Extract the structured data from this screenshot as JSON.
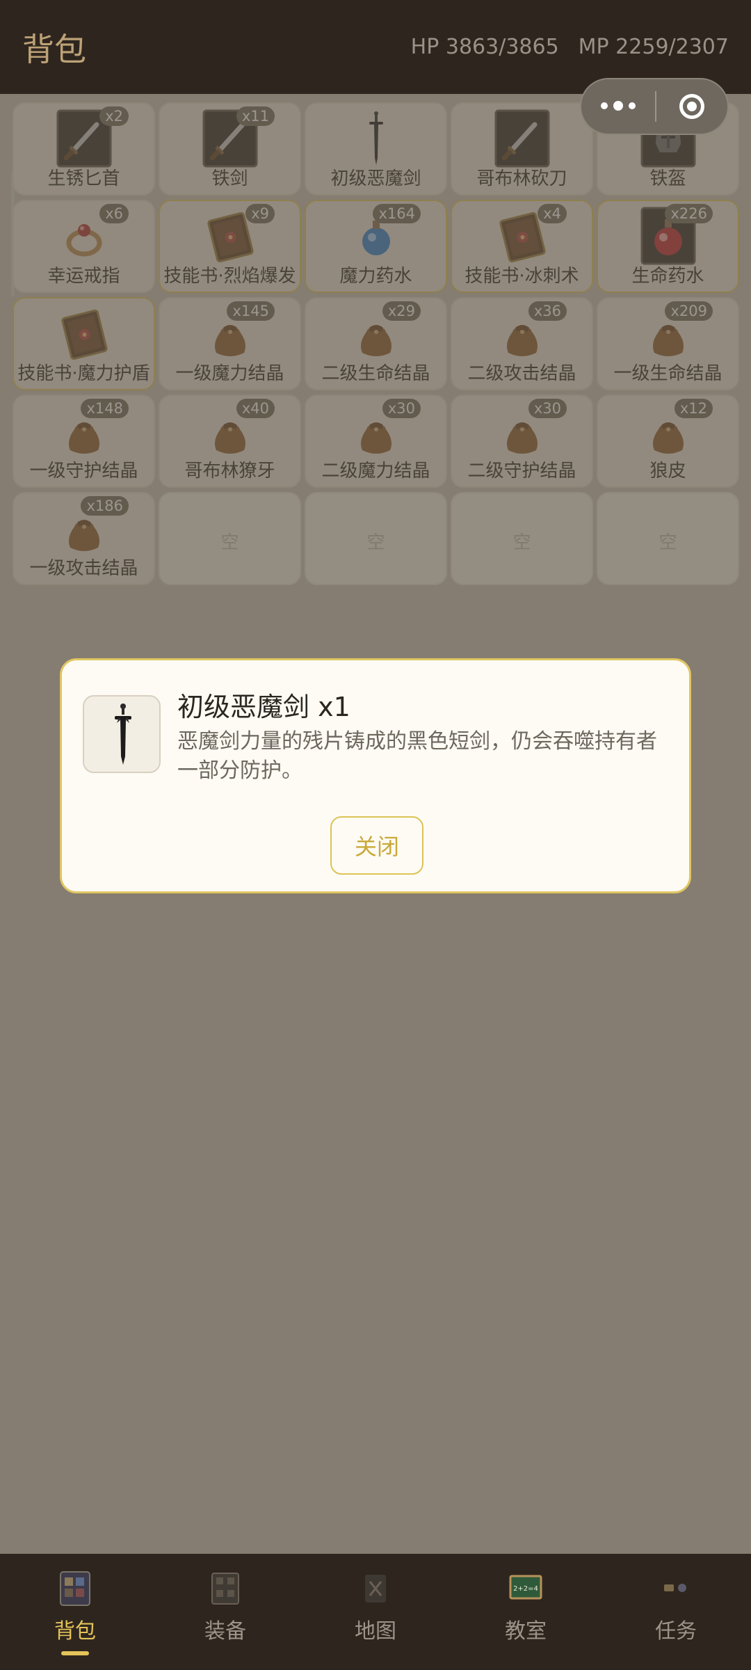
{
  "header": {
    "title": "背包",
    "hp": "HP 3863/3865",
    "mp": "MP 2259/2307"
  },
  "inventory": [
    {
      "name": "生锈匕首",
      "qty": "x2",
      "icon": "dagger-icon",
      "highlight": false
    },
    {
      "name": "铁剑",
      "qty": "x11",
      "icon": "sword-icon",
      "highlight": false
    },
    {
      "name": "初级恶魔剑",
      "qty": "",
      "icon": "demon-sword-icon",
      "highlight": false
    },
    {
      "name": "哥布林砍刀",
      "qty": "",
      "icon": "cleaver-icon",
      "highlight": false
    },
    {
      "name": "铁盔",
      "qty": "x",
      "icon": "helmet-icon",
      "highlight": false
    },
    {
      "name": "幸运戒指",
      "qty": "x6",
      "icon": "ring-icon",
      "highlight": false
    },
    {
      "name": "技能书·烈焰爆发",
      "qty": "x9",
      "icon": "skill-book-icon",
      "highlight": true
    },
    {
      "name": "魔力药水",
      "qty": "x164",
      "icon": "blue-potion-icon",
      "highlight": true
    },
    {
      "name": "技能书·冰刺术",
      "qty": "x4",
      "icon": "skill-book-icon",
      "highlight": true
    },
    {
      "name": "生命药水",
      "qty": "x226",
      "icon": "red-potion-icon",
      "highlight": true
    },
    {
      "name": "技能书·魔力护盾",
      "qty": "",
      "icon": "skill-book-icon",
      "highlight": true
    },
    {
      "name": "一级魔力结晶",
      "qty": "x145",
      "icon": "pouch-icon",
      "highlight": false
    },
    {
      "name": "二级生命结晶",
      "qty": "x29",
      "icon": "pouch-icon",
      "highlight": false
    },
    {
      "name": "二级攻击结晶",
      "qty": "x36",
      "icon": "pouch-icon",
      "highlight": false
    },
    {
      "name": "一级生命结晶",
      "qty": "x209",
      "icon": "pouch-icon",
      "highlight": false
    },
    {
      "name": "一级守护结晶",
      "qty": "x148",
      "icon": "pouch-icon",
      "highlight": false
    },
    {
      "name": "哥布林獠牙",
      "qty": "x40",
      "icon": "pouch-icon",
      "highlight": false
    },
    {
      "name": "二级魔力结晶",
      "qty": "x30",
      "icon": "pouch-icon",
      "highlight": false
    },
    {
      "name": "二级守护结晶",
      "qty": "x30",
      "icon": "pouch-icon",
      "highlight": false
    },
    {
      "name": "狼皮",
      "qty": "x12",
      "icon": "pouch-icon",
      "highlight": false
    },
    {
      "name": "一级攻击结晶",
      "qty": "x186",
      "icon": "pouch-icon",
      "highlight": false
    }
  ],
  "empty_label": "空",
  "empty_slots": 4,
  "modal": {
    "title": "初级恶魔剑 x1",
    "description": "恶魔剑力量的残片铸成的黑色短剑，仍会吞噬持有者一部分防护。",
    "close_label": "关闭",
    "icon": "demon-sword-icon"
  },
  "tabs": [
    {
      "label": "背包",
      "icon": "backpack-icon",
      "active": true
    },
    {
      "label": "装备",
      "icon": "equipment-icon",
      "active": false
    },
    {
      "label": "地图",
      "icon": "map-icon",
      "active": false
    },
    {
      "label": "教室",
      "icon": "blackboard-icon",
      "active": false
    },
    {
      "label": "任务",
      "icon": "quest-icon",
      "active": false
    }
  ],
  "colors": {
    "accent": "#e4c35a",
    "header_bg": "#2e261e",
    "panel_bg": "#e9e2d4"
  }
}
